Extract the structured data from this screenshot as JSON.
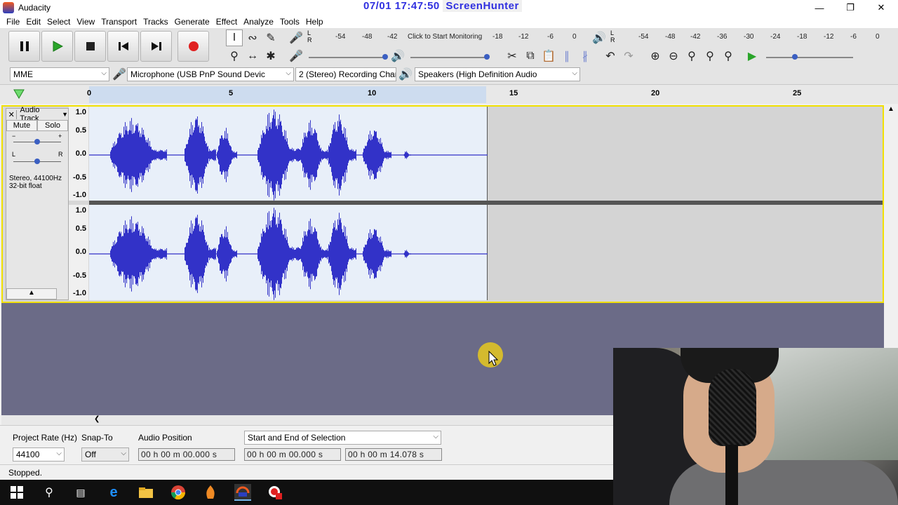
{
  "window": {
    "title": "Audacity",
    "overlay_datetime": "07/01  17:47:50",
    "overlay_brand": "ScreenHunter"
  },
  "menu": [
    "File",
    "Edit",
    "Select",
    "View",
    "Transport",
    "Tracks",
    "Generate",
    "Effect",
    "Analyze",
    "Tools",
    "Help"
  ],
  "meters": {
    "record_hint": "Click to Start Monitoring",
    "record_scale": [
      "-54",
      "-48",
      "-42",
      "-18",
      "-12",
      "-6",
      "0"
    ],
    "play_scale": [
      "-54",
      "-48",
      "-42",
      "-36",
      "-30",
      "-24",
      "-18",
      "-12",
      "-6",
      "0"
    ],
    "lr_l": "L",
    "lr_r": "R"
  },
  "devices": {
    "host": "MME",
    "input": "Microphone (USB PnP Sound Devic",
    "channels": "2 (Stereo) Recording Char",
    "output": "Speakers (High Definition Audio"
  },
  "timeline": {
    "ticks": [
      "0",
      "5",
      "10",
      "15",
      "20",
      "25"
    ]
  },
  "track": {
    "name": "Audio Track",
    "mute": "Mute",
    "solo": "Solo",
    "gain_minus": "−",
    "gain_plus": "+",
    "pan_l": "L",
    "pan_r": "R",
    "info_line1": "Stereo, 44100Hz",
    "info_line2": "32-bit float",
    "ruler": [
      "1.0",
      "0.5",
      "0.0",
      "-0.5",
      "-1.0"
    ]
  },
  "selection_toolbar": {
    "project_rate_label": "Project Rate (Hz)",
    "project_rate_value": "44100",
    "snap_to_label": "Snap-To",
    "snap_to_value": "Off",
    "audio_position_label": "Audio Position",
    "audio_position_value": "00 h 00 m 00.000 s",
    "selection_mode": "Start and End of Selection",
    "selection_start": "00 h 00 m 00.000 s",
    "selection_end": "00 h 00 m 14.078 s"
  },
  "status": "Stopped.",
  "colors": {
    "waveform": "#3232c8",
    "selection_bg": "#e8eff9",
    "track_border": "#f1e000",
    "record": "#e02020",
    "play": "#2aa52a"
  }
}
